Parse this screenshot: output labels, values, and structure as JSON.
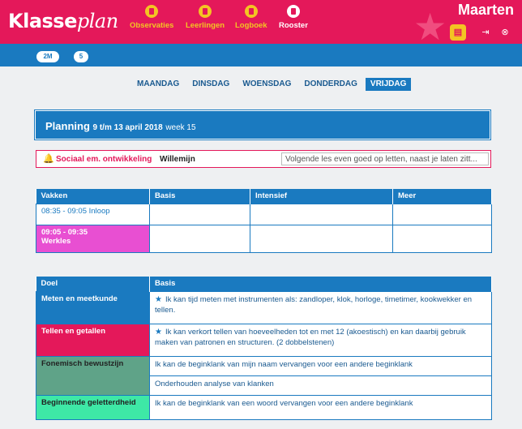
{
  "header": {
    "logo_prefix": "Klasse",
    "logo_script": "plan",
    "nav": [
      {
        "label": "Observaties",
        "icon": "observations-icon"
      },
      {
        "label": "Leerlingen",
        "icon": "students-icon"
      },
      {
        "label": "Logboek",
        "icon": "logbook-icon"
      },
      {
        "label": "Rooster",
        "icon": "schedule-icon"
      }
    ],
    "username": "Maarten",
    "colors": {
      "brand": "#e4185a",
      "accent": "#f3c423",
      "blue": "#1a7ac0"
    }
  },
  "groups": [
    "2M",
    "5"
  ],
  "days": [
    "MAANDAG",
    "DINSDAG",
    "WOENSDAG",
    "DONDERDAG",
    "VRIJDAG"
  ],
  "active_day": "VRIJDAG",
  "planning": {
    "title": "Planning",
    "range": "9 t/m 13 april 2018",
    "week": "week 15"
  },
  "focus": {
    "area": "Sociaal em. ontwikkeling",
    "student": "Willemijn",
    "note": "Volgende les even goed op letten, naast je laten zitt..."
  },
  "schedule": {
    "headers": [
      "Vakken",
      "Basis",
      "Intensief",
      "Meer"
    ],
    "rows": [
      {
        "label": "08:35 - 09:05 Inloop"
      },
      {
        "label_line1": "09:05 - 09:35",
        "label_line2": "Werkles"
      }
    ]
  },
  "goals": {
    "headers": [
      "Doel",
      "Basis"
    ],
    "rows": [
      {
        "category": "Meten en meetkunde",
        "color": "#1a7ac0",
        "goal": "Ik kan tijd meten met instrumenten als: zandloper, klok, horloge, timetimer, kookwekker en tellen."
      },
      {
        "category": "Tellen en getallen",
        "color": "#e4185a",
        "goal": "Ik kan verkort tellen van hoeveelheden tot en met 12 (akoestisch) en kan daarbij gebruik maken van patronen en structuren. (2 dobbelstenen)"
      },
      {
        "category": "Fonemisch bewustzijn",
        "color": "#5fa388",
        "goal": "Ik kan de beginklank van mijn naam vervangen voor een andere beginklank",
        "goal2": "Onderhouden analyse van klanken"
      },
      {
        "category": "Beginnende geletterdheid",
        "color": "#3ee8a6",
        "goal": "Ik kan de beginklank van een woord vervangen voor een andere beginklank"
      }
    ]
  }
}
